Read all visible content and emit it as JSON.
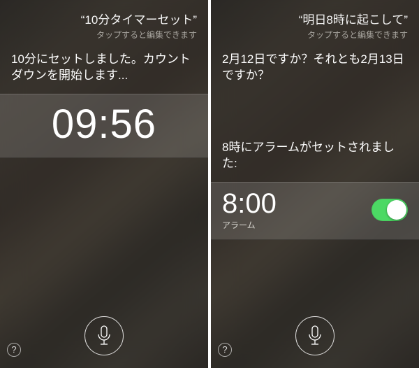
{
  "left": {
    "query": "“10分タイマーセット”",
    "hint": "タップすると編集できます",
    "response": "10分にセットしました。カウントダウンを開始します...",
    "timer": "09:56",
    "help": "?"
  },
  "right": {
    "query": "“明日8時に起こして”",
    "hint": "タップすると編集できます",
    "clarify": "2月12日ですか？それとも2月13日ですか？",
    "confirm": "8時にアラームがセットされました:",
    "alarm_time": "8:00",
    "alarm_label": "アラーム",
    "switch_on": true,
    "help": "?"
  }
}
